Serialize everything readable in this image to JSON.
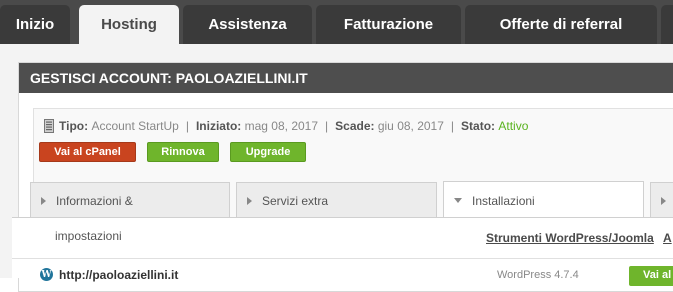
{
  "nav": {
    "tabs": [
      {
        "label": "Inizio",
        "active": false
      },
      {
        "label": "Hosting",
        "active": true
      },
      {
        "label": "Assistenza",
        "active": false
      },
      {
        "label": "Fatturazione",
        "active": false
      },
      {
        "label": "Offerte di referral",
        "active": false
      }
    ]
  },
  "panel": {
    "title": "GESTISCI ACCOUNT: PAOLOAZIELLINI.IT"
  },
  "account": {
    "tipo_label": "Tipo:",
    "tipo_value": "Account StartUp",
    "iniziato_label": "Iniziato:",
    "iniziato_value": "mag 08, 2017",
    "scade_label": "Scade:",
    "scade_value": "giu 08, 2017",
    "stato_label": "Stato:",
    "stato_value": "Attivo",
    "separator": "|"
  },
  "actions": {
    "cpanel": "Vai al cPanel",
    "rinnova": "Rinnova",
    "upgrade": "Upgrade"
  },
  "sections": {
    "tabs": [
      {
        "label": "Informazioni &",
        "active": false
      },
      {
        "label": "Servizi extra",
        "active": false
      },
      {
        "label": "Installazioni",
        "active": true
      }
    ],
    "tab1_continuation": "impostazioni",
    "tools_link": "Strumenti WordPress/Joomla",
    "tools_link2": "A"
  },
  "installations": [
    {
      "url": "http://paoloaziellini.it",
      "version": "WordPress 4.7.4",
      "button": "Vai al"
    }
  ],
  "colors": {
    "nav_bg": "#4a4a4a",
    "panel_header": "#4e4e4e",
    "red_button": "#c9441f",
    "green_button": "#6fb52c",
    "active_status": "#5ab31f"
  }
}
